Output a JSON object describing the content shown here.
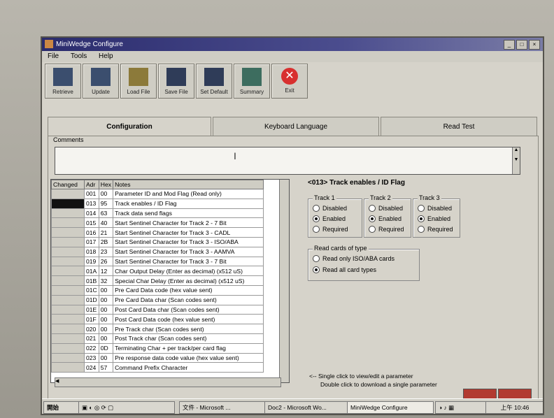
{
  "window": {
    "title": "MiniWedge Configure",
    "menu": [
      "File",
      "Tools",
      "Help"
    ]
  },
  "toolbar": [
    "Retrieve",
    "Update",
    "Load File",
    "Save File",
    "Set Default",
    "Summary",
    "Exit"
  ],
  "tabs": [
    "Configuration",
    "Keyboard Language",
    "Read Test"
  ],
  "comments_label": "Comments",
  "grid": {
    "headers": [
      "Changed",
      "Adr",
      "Hex",
      "Notes"
    ],
    "rows": [
      {
        "adr": "001",
        "hex": "00",
        "notes": "Parameter ID and Mod Flag (Read only)"
      },
      {
        "adr": "013",
        "hex": "95",
        "notes": "Track enables / ID Flag"
      },
      {
        "adr": "014",
        "hex": "63",
        "notes": "Track data send flags"
      },
      {
        "adr": "015",
        "hex": "40",
        "notes": "Start Sentinel Character for Track 2 - 7 Bit"
      },
      {
        "adr": "016",
        "hex": "21",
        "notes": "Start Sentinel Character for Track 3 - CADL"
      },
      {
        "adr": "017",
        "hex": "2B",
        "notes": "Start Sentinel Character for Track 3 - ISO/ABA"
      },
      {
        "adr": "018",
        "hex": "23",
        "notes": "Start Sentinel Character for Track 3 - AAMVA"
      },
      {
        "adr": "019",
        "hex": "26",
        "notes": "Start Sentinel Character for Track 3 - 7 Bit"
      },
      {
        "adr": "01A",
        "hex": "12",
        "notes": "Char Output Delay (Enter as decimal) (x512 uS)"
      },
      {
        "adr": "01B",
        "hex": "32",
        "notes": "Special Char Delay (Enter as decimal) (x512 uS)"
      },
      {
        "adr": "01C",
        "hex": "00",
        "notes": "Pre Card Data code (hex value sent)"
      },
      {
        "adr": "01D",
        "hex": "00",
        "notes": "Pre Card Data char (Scan codes sent)"
      },
      {
        "adr": "01E",
        "hex": "00",
        "notes": "Post Card Data char (Scan codes sent)"
      },
      {
        "adr": "01F",
        "hex": "00",
        "notes": "Post Card Data code (hex value sent)"
      },
      {
        "adr": "020",
        "hex": "00",
        "notes": "Pre Track char (Scan codes sent)"
      },
      {
        "adr": "021",
        "hex": "00",
        "notes": "Post Track char (Scan codes sent)"
      },
      {
        "adr": "022",
        "hex": "0D",
        "notes": "Terminating Char + per track/per card flag"
      },
      {
        "adr": "023",
        "hex": "00",
        "notes": "Pre response data code value (hex value sent)"
      },
      {
        "adr": "024",
        "hex": "57",
        "notes": "Command Prefix Character"
      }
    ]
  },
  "detail": {
    "title": "<013> Track enables / ID Flag",
    "tracks": [
      {
        "label": "Track 1",
        "options": [
          "Disabled",
          "Enabled",
          "Required"
        ],
        "selected": 1
      },
      {
        "label": "Track 2",
        "options": [
          "Disabled",
          "Enabled",
          "Required"
        ],
        "selected": 1
      },
      {
        "label": "Track 3",
        "options": [
          "Disabled",
          "Enabled",
          "Required"
        ],
        "selected": 1
      }
    ],
    "read_cards": {
      "label": "Read cards of type",
      "options": [
        "Read only ISO/ABA cards",
        "Read all card types"
      ],
      "selected": 1
    },
    "hint1": "<-- Single click to view/edit a parameter",
    "hint2": "Double click to download a single parameter"
  },
  "taskbar": {
    "start": "開始",
    "items": [
      "文件 - Microsoft ...",
      "Doc2 - Microsoft Wo...",
      "MiniWedge Configure"
    ],
    "clock": "上午 10:46"
  }
}
